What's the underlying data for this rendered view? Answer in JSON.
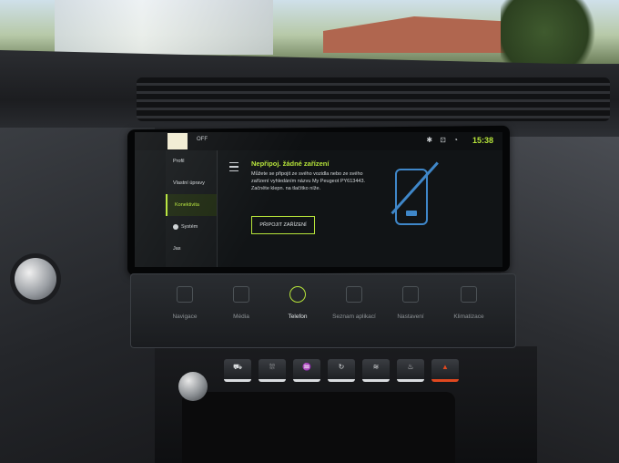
{
  "status_bar": {
    "off_label": "OFF",
    "icons": "✱ ⊡ ◔",
    "time": "15:38"
  },
  "sidebar": {
    "items": [
      {
        "label": "Profil"
      },
      {
        "label": "Vlastní úpravy"
      },
      {
        "label": "Konektivita"
      },
      {
        "label": "Systém"
      },
      {
        "label": "Jas"
      }
    ],
    "active_index": 2
  },
  "message": {
    "title": "Nepřipoj. žádné zařízení",
    "body": "Můžete se připojit ze svého vozidla nebo ze svého zařízení vyhledáním názvu My Peugeot PY613443. Začněte klepn. na tlačítko níže.",
    "button_label": "PŘIPOJIT ZAŘÍZENÍ"
  },
  "touch_bar": {
    "items": [
      {
        "label": "Navigace",
        "icon": "navigation-arrow-icon"
      },
      {
        "label": "Média",
        "icon": "music-icon"
      },
      {
        "label": "Telefon",
        "icon": "phone-icon"
      },
      {
        "label": "Seznam aplikací",
        "icon": "apps-icon"
      },
      {
        "label": "Nastavení",
        "icon": "gear-icon"
      },
      {
        "label": "Klimatizace",
        "icon": "climate-icon"
      }
    ],
    "active_index": 2
  },
  "hardware_buttons": [
    {
      "icon": "car-icon",
      "glyph": "⛟"
    },
    {
      "icon": "rear-defrost-icon",
      "glyph": "⛆"
    },
    {
      "icon": "front-defrost-icon",
      "glyph": "♒"
    },
    {
      "icon": "recirculation-icon",
      "glyph": "↻"
    },
    {
      "icon": "heated-window-icon",
      "glyph": "≋"
    },
    {
      "icon": "heated-seat-icon",
      "glyph": "♨"
    },
    {
      "icon": "hazard-icon",
      "glyph": "▲"
    }
  ],
  "colors": {
    "accent": "#b7e53a",
    "illustration": "#3f87c9",
    "hazard": "#e0481f"
  }
}
